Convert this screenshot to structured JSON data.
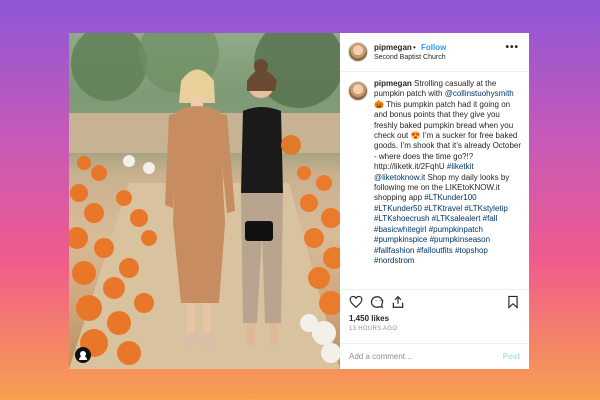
{
  "post": {
    "username": "pipmegan",
    "dot": "•",
    "follow_label": "Follow",
    "location": "Second Baptist Church",
    "more_label": "•••"
  },
  "caption": {
    "username": "pipmegan",
    "segments": [
      {
        "t": "Strolling casually at the pumpkin patch with ",
        "link": false
      },
      {
        "t": "@collinstuohysmith",
        "link": true
      },
      {
        "t": " 🎃 This pumpkin patch had it going on and bonus points that they give you freshly baked pumpkin bread when you check out 😍 I’m a sucker for free baked goods. I’m shook that it’s already October - where does the time go?!? http://liketk.it/2FqhU ",
        "link": false
      },
      {
        "t": "#liketkit",
        "link": true
      },
      {
        "t": " ",
        "link": false
      },
      {
        "t": "@liketoknow.it",
        "link": true
      },
      {
        "t": " Shop my daily looks by following me on the LIKEtoKNOW.it shopping app ",
        "link": false
      },
      {
        "t": "#LTKunder100 #LTKunder50 #LTKtravel #LTKstyletip #LTKshoecrush #LTKsalealert #fall #basicwhitegirl #pumpkinpatch #pumpkinspice #pumpkinseason #fallfashion #falloutfits #topshop #nordstrom",
        "link": true
      }
    ],
    "time": "13h"
  },
  "stats": {
    "likes": "1,450 likes",
    "ago": "13 HOURS AGO"
  },
  "comment": {
    "placeholder": "Add a comment...",
    "post_label": "Post"
  },
  "icons": [
    "heart-icon",
    "comment-icon",
    "share-icon",
    "bookmark-icon",
    "profile-icon"
  ],
  "colors": {
    "link": "#003569",
    "follow": "#3897f0",
    "post_disabled": "#b2dffc",
    "meta_gray": "#8e8e8e"
  }
}
